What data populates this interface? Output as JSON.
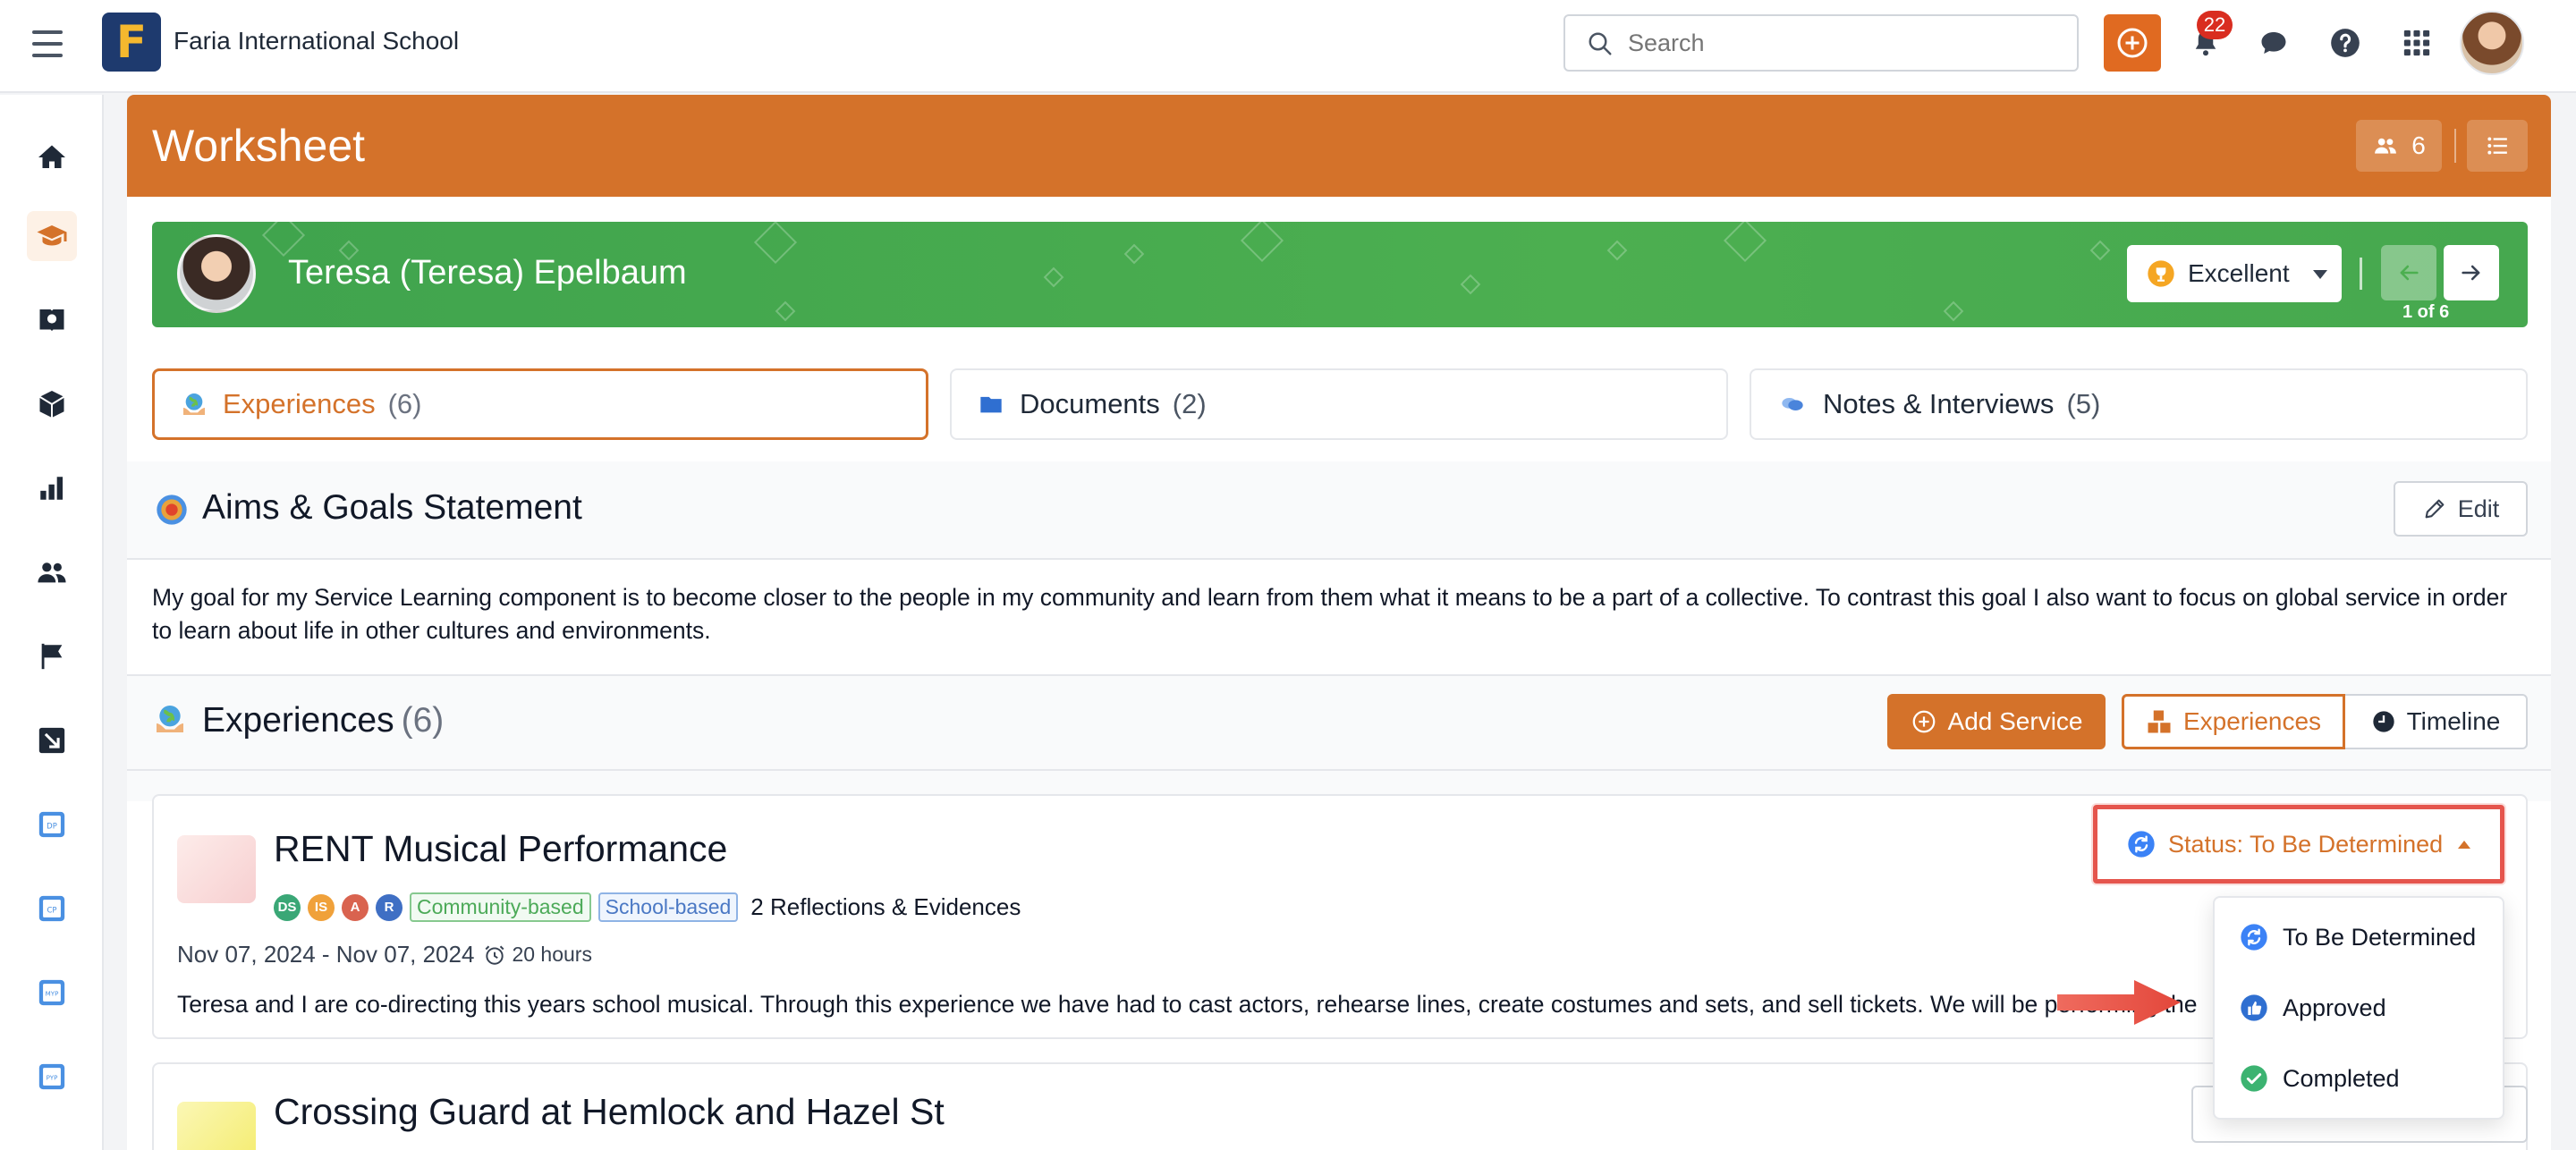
{
  "topbar": {
    "school_name": "Faria International School",
    "logo_letter": "F",
    "search_placeholder": "Search",
    "notification_count": "22"
  },
  "sidebar": {
    "items": [
      {
        "name": "home-icon"
      },
      {
        "name": "graduation-cap-icon",
        "active": true
      },
      {
        "name": "book-globe-icon"
      },
      {
        "name": "cube-icon"
      },
      {
        "name": "bar-chart-icon"
      },
      {
        "name": "users-icon"
      },
      {
        "name": "flag-icon"
      },
      {
        "name": "export-icon"
      },
      {
        "name": "dp-icon"
      },
      {
        "name": "cp-icon"
      },
      {
        "name": "myp-icon"
      },
      {
        "name": "pyp-icon"
      }
    ]
  },
  "worksheet": {
    "title": "Worksheet",
    "people_count": "6"
  },
  "student": {
    "name": "Teresa (Teresa) Epelbaum",
    "grade": "Excellent",
    "page_indicator": "1 of 6"
  },
  "tabs": [
    {
      "label": "Experiences",
      "count": "(6)",
      "active": true
    },
    {
      "label": "Documents",
      "count": "(2)"
    },
    {
      "label": "Notes & Interviews",
      "count": "(5)"
    }
  ],
  "aims": {
    "title": "Aims & Goals Statement",
    "edit_label": "Edit",
    "text": "My goal for my Service Learning component is to become closer to the people in my community and learn from them what it means to be a part of a collective. To contrast this goal I also want to focus on global service in order to learn about life in other cultures and environments."
  },
  "experiences": {
    "title": "Experiences",
    "count": "(6)",
    "add_service_label": "Add Service",
    "view_experiences_label": "Experiences",
    "view_timeline_label": "Timeline",
    "items": [
      {
        "title": "RENT Musical Performance",
        "tags": [
          "DS",
          "IS",
          "A",
          "R"
        ],
        "pills": [
          "Community-based",
          "School-based"
        ],
        "reflections": "2 Reflections & Evidences",
        "dates": "Nov 07, 2024 - Nov 07, 2024",
        "hours": "20 hours",
        "description": "Teresa and I are co-directing this years school musical. Through this experience we have had to cast actors, rehearse lines, create costumes and sets, and sell tickets. We will be performing the",
        "status": "Status: To Be Determined"
      },
      {
        "title": "Crossing Guard at Hemlock and Hazel St"
      }
    ]
  },
  "status_menu": {
    "options": [
      "To Be Determined",
      "Approved",
      "Completed"
    ]
  },
  "colors": {
    "brand_orange": "#d4722a",
    "banner_green": "#4caf50",
    "highlight_red": "#e5554d"
  }
}
